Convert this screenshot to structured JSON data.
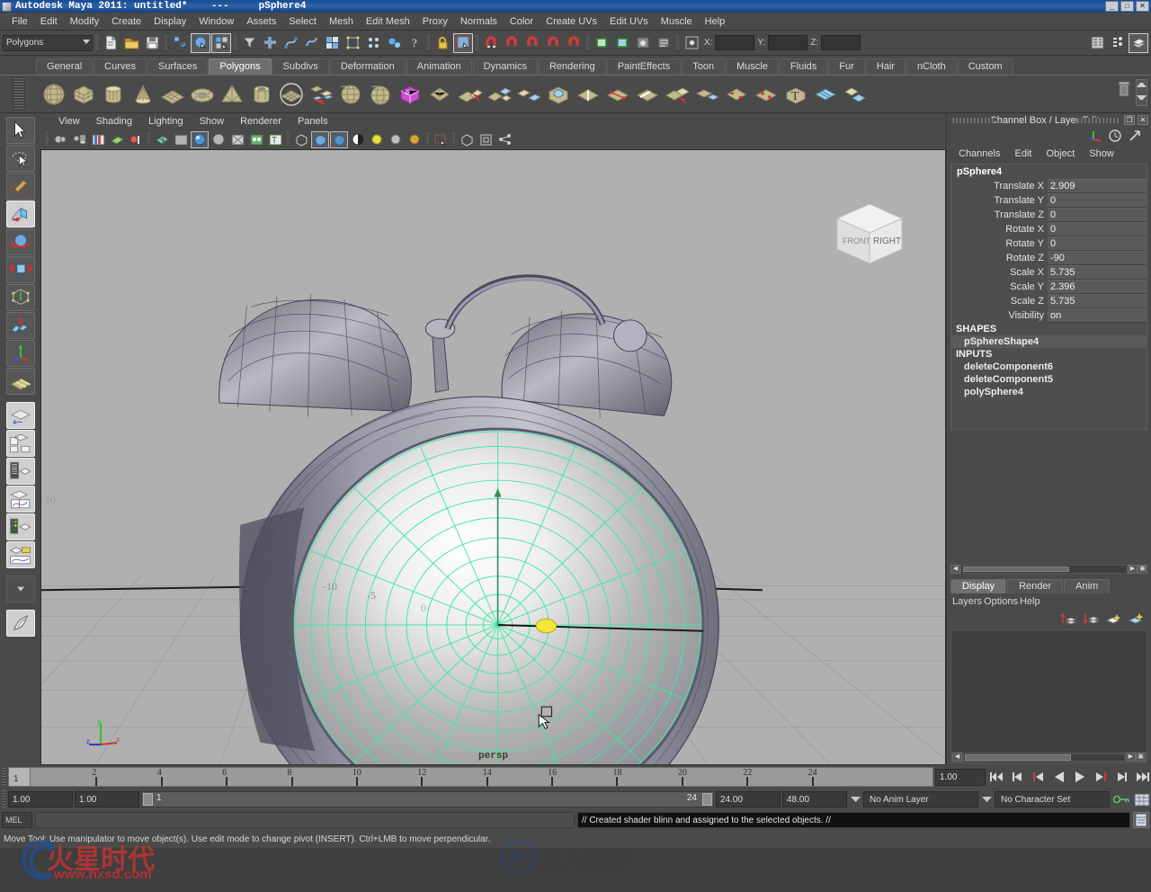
{
  "titlebar": {
    "text": "Autodesk Maya 2011: untitled*    ---     pSphere4",
    "minimize": "_",
    "maximize": "□",
    "close": "✕"
  },
  "menubar": {
    "items": [
      "File",
      "Edit",
      "Modify",
      "Create",
      "Display",
      "Window",
      "Assets",
      "Select",
      "Mesh",
      "Edit Mesh",
      "Proxy",
      "Normals",
      "Color",
      "Create UVs",
      "Edit UVs",
      "Muscle",
      "Help"
    ]
  },
  "statusline": {
    "mode_selected": "Polygons",
    "coord_x_label": "X:",
    "coord_y_label": "Y:",
    "coord_z_label": "Z:",
    "coord_x_value": "",
    "coord_y_value": "",
    "coord_z_value": "",
    "icons": [
      "new-scene-icon",
      "open-scene-icon",
      "save-scene-icon",
      "undo-icon",
      "redo-icon",
      "select-by-hierarchy-icon",
      "select-by-object-icon",
      "select-by-component-icon",
      "select-mask-icon",
      "snap-grid-icon",
      "snap-curve-icon",
      "snap-point-icon",
      "snap-view-plane-icon",
      "snap-normal-icon",
      "construction-history-icon",
      "lock-icon",
      "highlight-icon",
      "magnet-grid-icon",
      "magnet-curve-icon",
      "magnet-point-icon",
      "magnet-view-icon",
      "render-current-frame-icon",
      "ipr-render-icon",
      "render-settings-icon",
      "open-outliner-icon",
      "open-attribute-editor-icon",
      "open-channelbox-icon"
    ]
  },
  "shelf": {
    "tabs": [
      "General",
      "Curves",
      "Surfaces",
      "Polygons",
      "Subdivs",
      "Deformation",
      "Animation",
      "Dynamics",
      "Rendering",
      "PaintEffects",
      "Toon",
      "Muscle",
      "Fluids",
      "Fur",
      "Hair",
      "nCloth",
      "Custom"
    ],
    "active_tab": "Polygons",
    "trash_icon": "trash-icon",
    "buttons": [
      "poly-sphere-icon",
      "poly-cube-icon",
      "poly-cylinder-icon",
      "poly-cone-icon",
      "poly-plane-icon",
      "poly-torus-icon",
      "poly-pyramid-icon",
      "poly-pipe-icon",
      "poly-prism-icon",
      "poly-helix-icon",
      "poly-soccer-ball-icon",
      "poly-platonic-icon",
      "poly-sculpt-icon",
      "combine-icon",
      "booleans-icon",
      "smooth-icon",
      "mirror-geometry-icon",
      "extrude-icon",
      "bevel-icon",
      "split-polygon-icon",
      "insert-edge-loop-icon",
      "append-polygon-icon",
      "poly-cut-faces-icon",
      "poly-crease-icon",
      "poly-merge-icon",
      "text-icon",
      "uv-editor-icon",
      "poly-sculpt-geometry-icon"
    ]
  },
  "toolbox": {
    "tools": [
      {
        "name": "select-tool",
        "state": "normal"
      },
      {
        "name": "lasso-select-tool",
        "state": "normal"
      },
      {
        "name": "paint-select-tool",
        "state": "normal"
      },
      {
        "name": "move-tool",
        "state": "lit"
      },
      {
        "name": "rotate-tool",
        "state": "normal"
      },
      {
        "name": "scale-tool",
        "state": "normal"
      },
      {
        "name": "universal-manipulator-tool",
        "state": "normal"
      },
      {
        "name": "soft-modification-tool",
        "state": "normal"
      },
      {
        "name": "show-manipulator-tool",
        "state": "normal"
      },
      {
        "name": "last-tool-used",
        "state": "normal"
      },
      {
        "name": "single-perspective-view-layout",
        "state": "lit"
      },
      {
        "name": "four-view-layout",
        "state": "lit"
      },
      {
        "name": "outliner-persp-layout",
        "state": "lit"
      },
      {
        "name": "persp-graph-layout",
        "state": "lit"
      },
      {
        "name": "hypershade-persp-layout",
        "state": "lit"
      },
      {
        "name": "persp-trax-layout",
        "state": "lit"
      },
      {
        "name": "more-layouts-icon",
        "state": "dark"
      },
      {
        "name": "paint-effects-icon",
        "state": "lit"
      }
    ]
  },
  "viewport": {
    "menu": [
      "View",
      "Shading",
      "Lighting",
      "Show",
      "Renderer",
      "Panels"
    ],
    "toolbar_icons": [
      "select-camera-icon",
      "camera-attributes-icon",
      "bookmark-icon",
      "image-plane-icon",
      "two-sided-lighting-icon",
      "wireframe-icon",
      "smooth-shade-icon",
      "smooth-shade-all-icon",
      "shaded-wireframe-icon",
      "textured-icon",
      "use-all-lights-icon",
      "hardware-texturing-icon",
      "xray-icon",
      "xray-joints-icon",
      "shadows-icon",
      "occlusion-icon",
      "high-quality-render-icon",
      "isolate-select-icon",
      "grid-toggle-icon",
      "film-gate-icon",
      "resolution-gate-icon"
    ],
    "camera_label": "persp",
    "viewcube_faces": {
      "front": "FRONT",
      "right": "RIGHT"
    },
    "grid_labels": [
      "-10",
      "-5",
      "0",
      "10",
      "-10"
    ],
    "axis_labels": {
      "x": "x",
      "y": "y",
      "z": "z"
    }
  },
  "channelbox": {
    "title": "Channel Box / Layer Editor",
    "restore_icon": "restore-panel-icon",
    "close_icon": "close-panel-icon",
    "header_icons": [
      "manipulator-icon",
      "clock-icon",
      "arrow-icon"
    ],
    "menu": [
      "Channels",
      "Edit",
      "Object",
      "Show"
    ],
    "object_name": "pSphere4",
    "attributes": [
      {
        "name": "Translate X",
        "value": "2.909"
      },
      {
        "name": "Translate Y",
        "value": "0"
      },
      {
        "name": "Translate Z",
        "value": "0"
      },
      {
        "name": "Rotate X",
        "value": "0"
      },
      {
        "name": "Rotate Y",
        "value": "0"
      },
      {
        "name": "Rotate Z",
        "value": "-90"
      },
      {
        "name": "Scale X",
        "value": "5.735"
      },
      {
        "name": "Scale Y",
        "value": "2.396"
      },
      {
        "name": "Scale Z",
        "value": "5.735"
      },
      {
        "name": "Visibility",
        "value": "on"
      }
    ],
    "shapes_header": "SHAPES",
    "shapes": [
      "pSphereShape4"
    ],
    "inputs_header": "INPUTS",
    "inputs": [
      "deleteComponent6",
      "deleteComponent5",
      "polySphere4"
    ]
  },
  "layereditor": {
    "tabs": [
      "Display",
      "Render",
      "Anim"
    ],
    "active_tab": "Display",
    "menu": [
      "Layers",
      "Options",
      "Help"
    ],
    "icons": [
      "create-empty-layer-icon",
      "create-layer-from-selected-icon",
      "new-layer-icon",
      "new-layer-selected-icon"
    ]
  },
  "timeline": {
    "ticks": [
      "2",
      "4",
      "6",
      "8",
      "10",
      "12",
      "14",
      "16",
      "18",
      "20",
      "22",
      "24"
    ],
    "current_frame_label": "1",
    "current_frame_field": "1.00",
    "playback_buttons": [
      "go-to-start-icon",
      "step-back-frame-icon",
      "step-back-key-icon",
      "play-backwards-icon",
      "play-forwards-icon",
      "step-forward-key-icon",
      "step-forward-frame-icon",
      "go-to-end-icon"
    ]
  },
  "rangeslider": {
    "anim_start": "1.00",
    "range_start": "1.00",
    "range_left_label": "1",
    "range_right_label": "24",
    "range_end": "24.00",
    "anim_end": "48.00",
    "anim_layer": "No Anim Layer",
    "character_set": "No Character Set",
    "auto_key_icon": "auto-key-icon",
    "anim_prefs_icon": "animation-preferences-icon"
  },
  "commandline": {
    "mel_label": "MEL",
    "input_value": "",
    "message": "// Created shader blinn and assigned to the selected objects. //",
    "script_editor_icon": "script-editor-icon"
  },
  "helpline": {
    "text": "Move Tool: Use manipulator to move object(s).  Use edit mode to change pivot (INSERT).  Ctrl+LMB to move perpendicular."
  },
  "watermarks": {
    "brand_cn": "火星时代",
    "brand_url": "www.hxsd.com",
    "brand2_cn": "人人素材"
  },
  "colors": {
    "title_blue": "#245a9e",
    "panel_gray": "#4a4a4a",
    "viewport_gray": "#b0b0b0",
    "wireframe_green": "#3ee8a0",
    "shelf_gold": "#bfb78a",
    "accent_red": "#c43a3a"
  }
}
